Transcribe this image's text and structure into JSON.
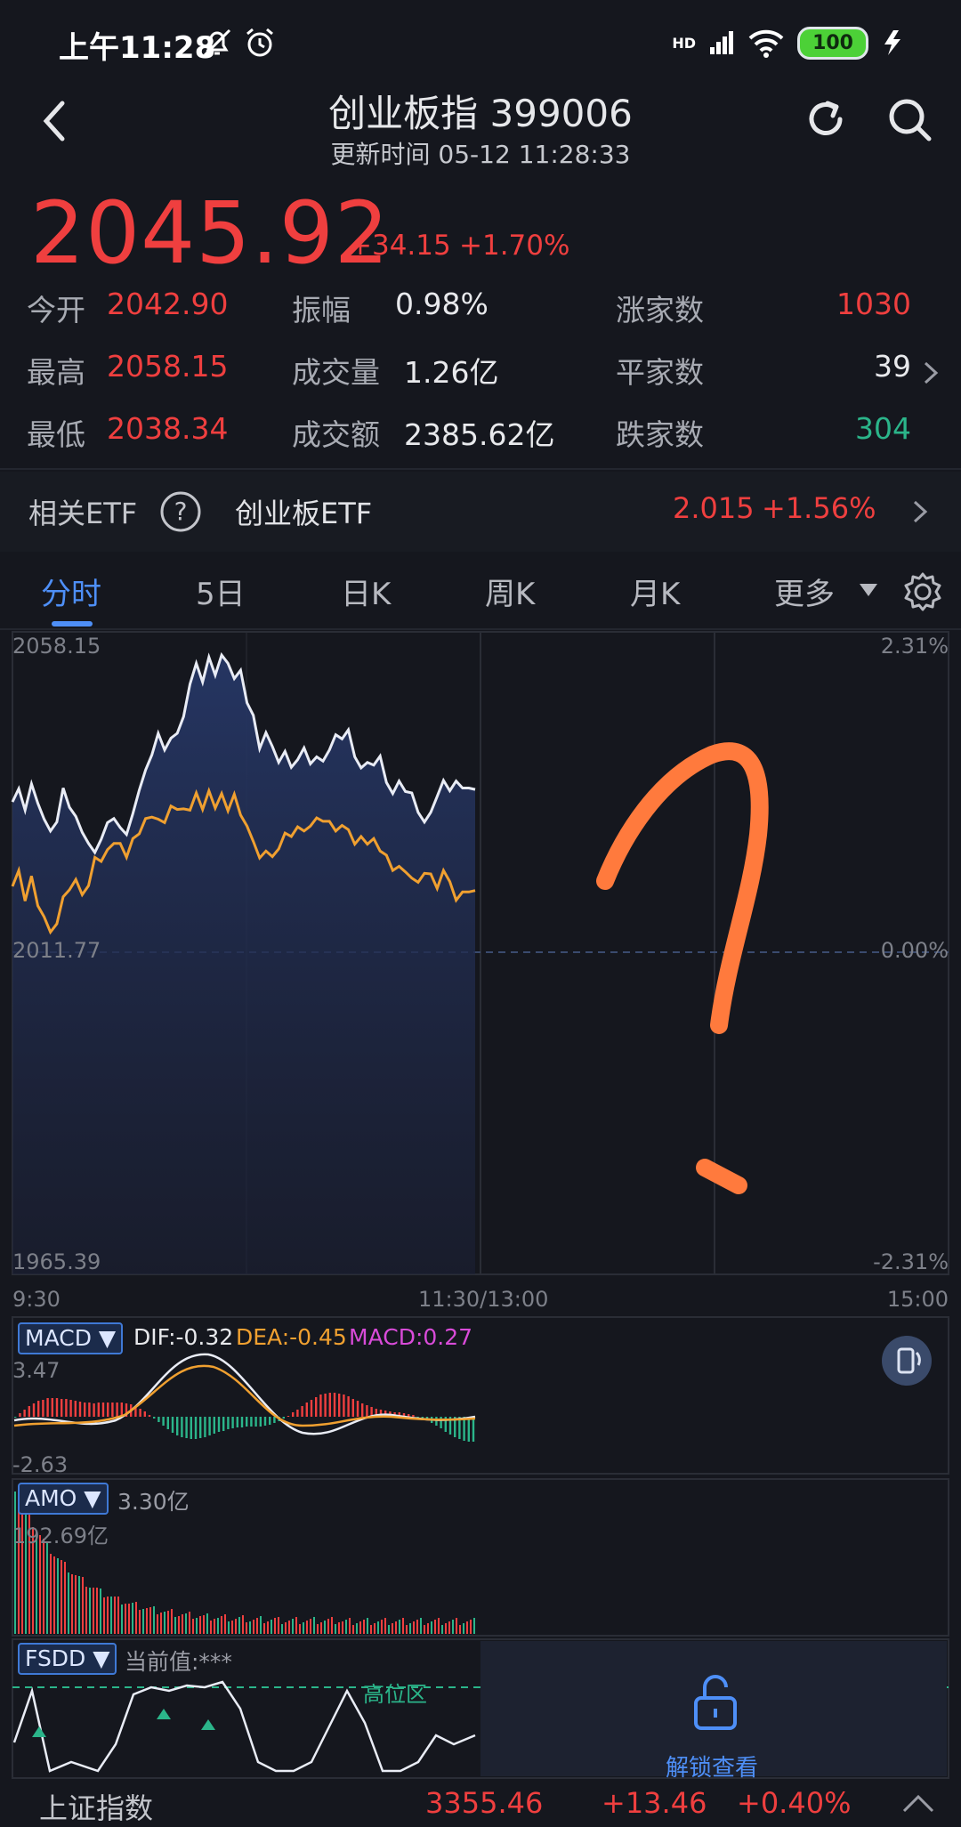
{
  "status_bar": {
    "time": "上午11:28",
    "signal": "HD",
    "battery": "100"
  },
  "header": {
    "title": "创业板指 399006",
    "update_time": "更新时间 05-12 11:28:33"
  },
  "quote": {
    "price": "2045.92",
    "change": "+34.15",
    "change_pct": "+1.70%"
  },
  "stats": [
    {
      "label": "今开",
      "value": "2042.90"
    },
    {
      "label": "振幅",
      "value": "0.98%"
    },
    {
      "label": "涨家数",
      "value": "1030"
    },
    {
      "label": "最高",
      "value": "2058.15"
    },
    {
      "label": "成交量",
      "value": "1.26亿"
    },
    {
      "label": "平家数",
      "value": "39"
    },
    {
      "label": "最低",
      "value": "2038.34"
    },
    {
      "label": "成交额",
      "value": "2385.62亿"
    },
    {
      "label": "跌家数",
      "value": "304"
    }
  ],
  "etf": {
    "label": "相关ETF",
    "name": "创业板ETF",
    "price": "2.015",
    "change_pct": "+1.56%"
  },
  "tabs": [
    "分时",
    "5日",
    "日K",
    "周K",
    "月K",
    "更多"
  ],
  "chart": {
    "y_top": "2058.15",
    "y_mid": "2011.77",
    "y_bottom": "1965.39",
    "pct_top": "2.31%",
    "pct_mid": "0.00%",
    "pct_bottom": "-2.31%",
    "x_start": "9:30",
    "x_mid": "11:30/13:00",
    "x_end": "15:00"
  },
  "macd": {
    "tag": "MACD ▼",
    "dif": "DIF:-0.32",
    "dea": "DEA:-0.45",
    "macd": "MACD:0.27",
    "top": "3.47",
    "bottom": "-2.63"
  },
  "amo": {
    "tag": "AMO ▼",
    "value": "3.30亿",
    "top": "192.69亿"
  },
  "fsdd": {
    "tag": "FSDD ▼",
    "current": "当前值:***",
    "zone": "高位区",
    "unlock": "解锁查看"
  },
  "bottom_bar": {
    "name": "上证指数",
    "price": "3355.46",
    "change": "+13.46",
    "change_pct": "+0.40%"
  },
  "colors": {
    "up": "#ef3f3f",
    "down": "#2bb58a",
    "accent": "#4e8ff7",
    "avg_line": "#f0a030"
  },
  "chart_data": {
    "type": "line",
    "x_range": [
      "9:30",
      "15:00"
    ],
    "ylim": [
      1965.39,
      2058.15
    ],
    "series": [
      {
        "values": [
          2033.6,
          2035.5,
          2032.4,
          2036.2,
          2033.4,
          2031.1,
          2029.4,
          2030.7,
          2035.6,
          2032.8,
          2031.5,
          2029.2,
          2027.6,
          2026.3,
          2028.2,
          2030.6,
          2031.2,
          2029.9,
          2028.9,
          2031.9,
          2035.3,
          2038.2,
          2040.4,
          2043.5,
          2041.1,
          2042.8,
          2043.5,
          2045.9,
          2050.6,
          2053.6,
          2050.9,
          2054.5,
          2051.9,
          2054.8,
          2053.6,
          2051.4,
          2052.6,
          2047.9,
          2046.1,
          2041.3,
          2043.6,
          2041.6,
          2039.3,
          2040.9,
          2038.6,
          2039.7,
          2041.4,
          2039.1,
          2040.1,
          2039.5,
          2041.1,
          2043.3,
          2042.7,
          2044.0,
          2040.1,
          2038.5,
          2039.3,
          2038.9,
          2040.2,
          2036.4,
          2034.8,
          2036.6,
          2035.1,
          2034.9,
          2032.1,
          2030.7,
          2032.1,
          2034.4,
          2036.7,
          2035.2,
          2036.6,
          2035.6,
          2035.6,
          2035.4
        ]
      },
      {
        "values": [
          2021.4,
          2023.7,
          2019.3,
          2022.9,
          2018.6,
          2017.0,
          2014.8,
          2016.0,
          2019.9,
          2020.9,
          2022.4,
          2020.2,
          2021.5,
          2025.6,
          2025.0,
          2026.7,
          2027.6,
          2027.6,
          2025.6,
          2028.3,
          2029.0,
          2031.2,
          2031.4,
          2031.1,
          2030.6,
          2033.0,
          2032.5,
          2032.6,
          2032.4,
          2034.9,
          2032.5,
          2035.2,
          2032.7,
          2034.8,
          2032.3,
          2034.7,
          2031.7,
          2030.1,
          2027.9,
          2025.5,
          2026.5,
          2025.7,
          2026.8,
          2029.1,
          2028.6,
          2030.0,
          2029.4,
          2030.1,
          2031.3,
          2030.8,
          2030.8,
          2029.4,
          2030.2,
          2029.6,
          2027.5,
          2028.6,
          2027.5,
          2028.3,
          2026.5,
          2025.9,
          2023.7,
          2024.3,
          2023.5,
          2022.6,
          2022.0,
          2023.3,
          2023.2,
          2021.1,
          2023.7,
          2022.1,
          2019.4,
          2020.6,
          2020.6,
          2020.8
        ]
      }
    ]
  }
}
